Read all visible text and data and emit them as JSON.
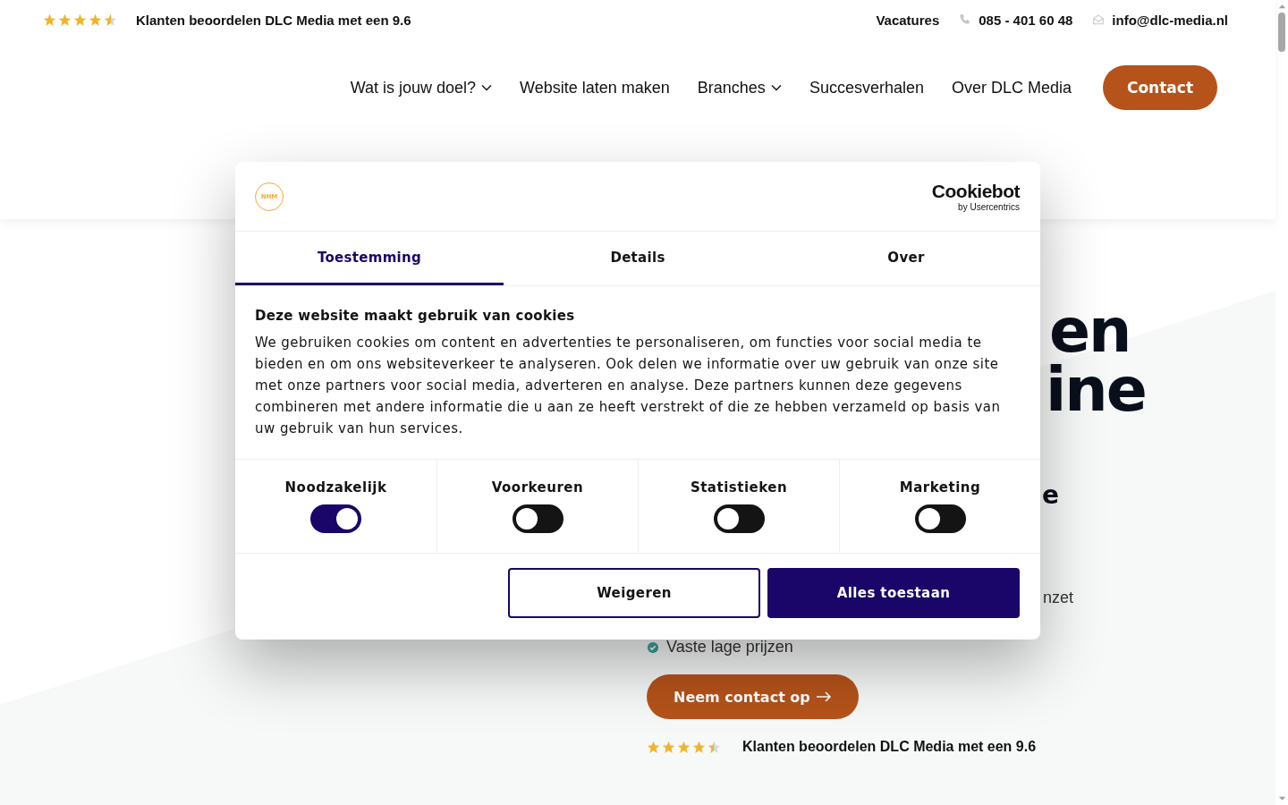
{
  "top_bar": {
    "rating": {
      "stars": 4.5,
      "text": "Klanten beoordelen DLC Media met een 9.6"
    },
    "links": [
      {
        "kind": "text",
        "label": "Vacatures"
      },
      {
        "kind": "phone",
        "label": "085 - 401 60 48"
      },
      {
        "kind": "mail",
        "label": "info@dlc-media.nl"
      }
    ]
  },
  "nav": {
    "items": [
      {
        "label": "Wat is jouw doel?",
        "dropdown": true
      },
      {
        "label": "Website laten maken",
        "dropdown": false
      },
      {
        "label": "Branches",
        "dropdown": true
      },
      {
        "label": "Succesverhalen",
        "dropdown": false
      },
      {
        "label": "Over DLC Media",
        "dropdown": false
      }
    ],
    "cta": "Contact"
  },
  "hero": {
    "heading_lines": [
      "en",
      "ine"
    ],
    "subheading": "e",
    "feature_fragment": "nzet",
    "feature": "Vaste lage prijzen",
    "button": "Neem contact op",
    "rating": {
      "stars": 4.5,
      "text": "Klanten beoordelen DLC Media met een 9.6"
    }
  },
  "cookie_dialog": {
    "logo": "NHM",
    "brand": {
      "name": "Cookiebot",
      "byline": "by Usercentrics"
    },
    "tabs": [
      {
        "label": "Toestemming",
        "selected": true
      },
      {
        "label": "Details",
        "selected": false
      },
      {
        "label": "Over",
        "selected": false
      }
    ],
    "title": "Deze website maakt gebruik van cookies",
    "text": "We gebruiken cookies om content en advertenties te personaliseren, om functies voor social media te bieden en om ons websiteverkeer te analyseren. Ook delen we informatie over uw gebruik van onze site met onze partners voor social media, adverteren en analyse. Deze partners kunnen deze gegevens combineren met andere informatie die u aan ze heeft verstrekt of die ze hebben verzameld op basis van uw gebruik van hun services.",
    "categories": [
      {
        "label": "Noodzakelijk",
        "on": true
      },
      {
        "label": "Voorkeuren",
        "on": false
      },
      {
        "label": "Statistieken",
        "on": false
      },
      {
        "label": "Marketing",
        "on": false
      }
    ],
    "buttons": [
      {
        "label": "Weigeren",
        "kind": "outline"
      },
      {
        "label": "Alles toestaan",
        "kind": "primary"
      }
    ]
  }
}
